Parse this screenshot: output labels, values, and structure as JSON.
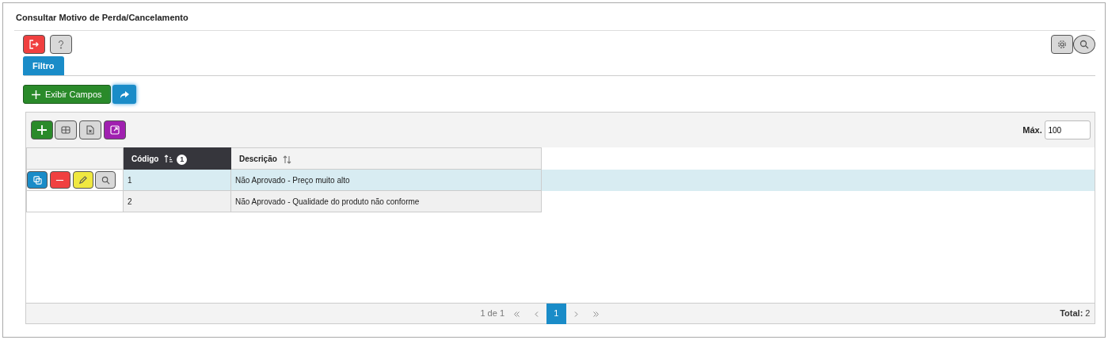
{
  "title": "Consultar Motivo de Perda/Cancelamento",
  "tabs": [
    {
      "label": "Filtro",
      "selected": true
    }
  ],
  "show_fields": "Exibir Campos",
  "grid": {
    "max_label": "Máx.",
    "max_value": "100",
    "columns": [
      {
        "label": "Código",
        "kind": "sorted",
        "sort_badge": "1"
      },
      {
        "label": "Descrição",
        "kind": "sortable"
      }
    ],
    "rows": [
      {
        "cells": [
          "1",
          "Não Aprovado - Preço muito alto"
        ],
        "selected": true
      },
      {
        "cells": [
          "2",
          "Não Aprovado - Qualidade do produto não conforme"
        ],
        "selected": false
      }
    ],
    "pager": {
      "info": "1 de 1",
      "pages": [
        {
          "label": "1",
          "selected": true
        }
      ]
    },
    "total": "**Total:** 2"
  }
}
